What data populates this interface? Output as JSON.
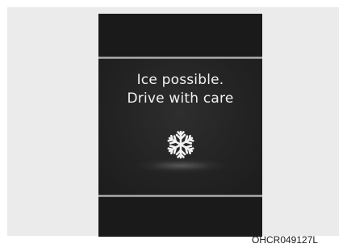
{
  "display": {
    "message_line1": "Ice possible.",
    "message_line2": "Drive with care",
    "icon": "snowflake-icon"
  },
  "figure_code": "OHCR049127L",
  "colors": {
    "display_background": "#1a1a1a",
    "text": "#f2f2f2",
    "frame_background": "#ebebeb"
  }
}
